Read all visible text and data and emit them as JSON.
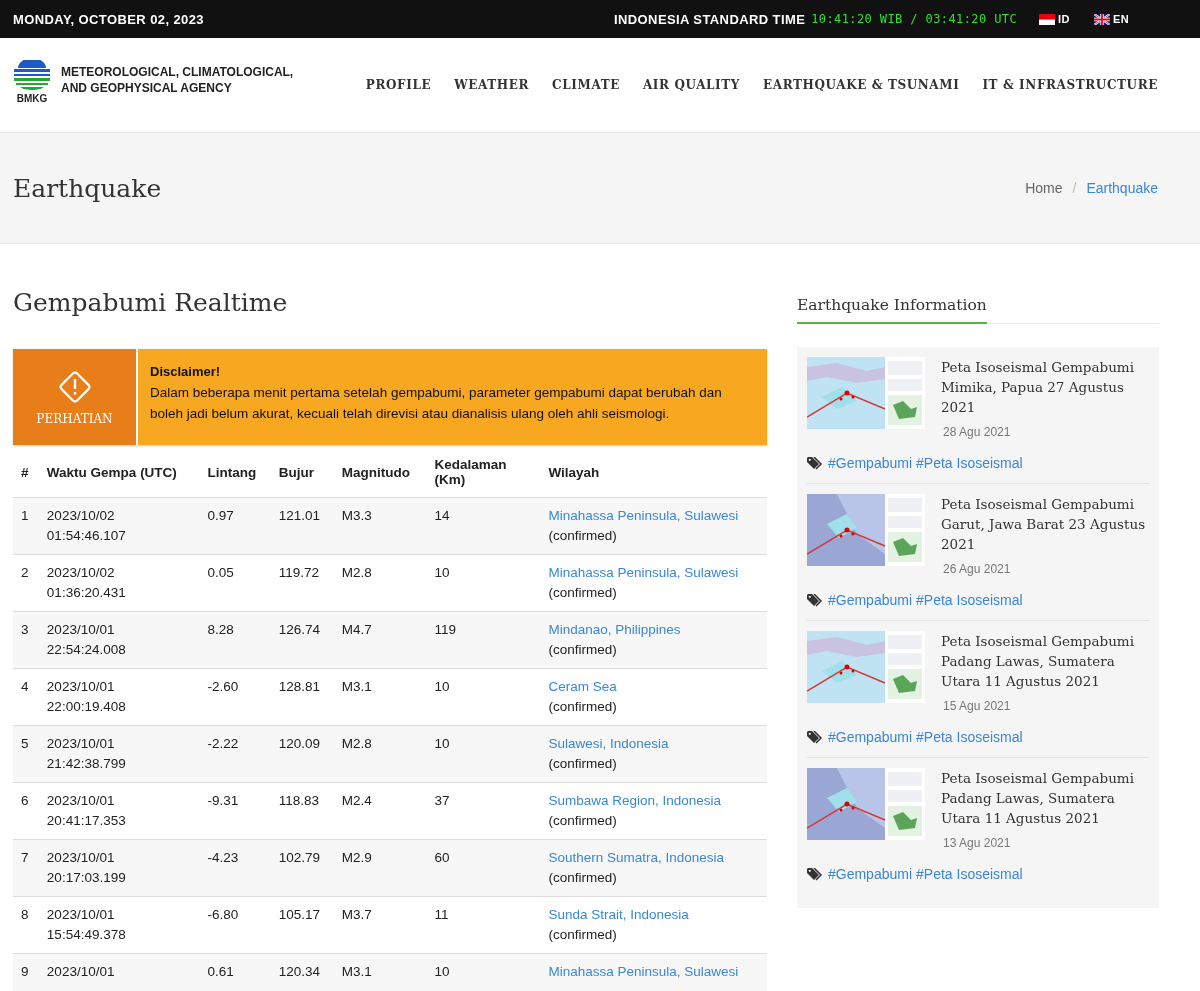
{
  "topbar": {
    "date": "MONDAY, OCTOBER 02, 2023",
    "time_label": "INDONESIA STANDARD TIME",
    "clock": "10:41:20 WIB / 03:41:20 UTC",
    "languages": [
      {
        "code": "ID",
        "kind": "indonesia"
      },
      {
        "code": "EN",
        "kind": "britain"
      }
    ]
  },
  "header": {
    "logo_text": "BMKG",
    "agency": "METEOROLOGICAL, CLIMATOLOGICAL, AND GEOPHYSICAL AGENCY",
    "nav": [
      "PROFILE",
      "WEATHER",
      "CLIMATE",
      "AIR QUALITY",
      "EARTHQUAKE & TSUNAMI",
      "IT & INFRASTRUCTURE"
    ]
  },
  "page_title": "Earthquake",
  "breadcrumb": [
    {
      "label": "Home",
      "current": false
    },
    {
      "separator": "/",
      "label": "Earthquake",
      "current": true
    }
  ],
  "section_title": "Gempabumi Realtime",
  "alert": {
    "label": "PERHATIAN",
    "title": "Disclaimer!",
    "text": "Dalam beberapa menit pertama setelah gempabumi, parameter gempabumi dapat berubah dan boleh jadi belum akurat, kecuali telah direvisi atau dianalisis ulang oleh ahli seismologi."
  },
  "table": {
    "columns": [
      "#",
      "Waktu Gempa (UTC)",
      "Lintang",
      "Bujur",
      "Magnitudo",
      "Kedalaman (Km)",
      "Wilayah"
    ],
    "rows": [
      {
        "no": "1",
        "date": "2023/10/02",
        "time": "01:54:46.107",
        "lat": "0.97",
        "lon": "121.01",
        "mag": "M3.3",
        "depth": "14",
        "region": "Minahassa Peninsula, Sulawesi",
        "status": "(confirmed)"
      },
      {
        "no": "2",
        "date": "2023/10/02",
        "time": "01:36:20.431",
        "lat": "0.05",
        "lon": "119.72",
        "mag": "M2.8",
        "depth": "10",
        "region": "Minahassa Peninsula, Sulawesi",
        "status": "(confirmed)"
      },
      {
        "no": "3",
        "date": "2023/10/01",
        "time": "22:54:24.008",
        "lat": "8.28",
        "lon": "126.74",
        "mag": "M4.7",
        "depth": "119",
        "region": "Mindanao, Philippines",
        "status": "(confirmed)"
      },
      {
        "no": "4",
        "date": "2023/10/01",
        "time": "22:00:19.408",
        "lat": "-2.60",
        "lon": "128.81",
        "mag": "M3.1",
        "depth": "10",
        "region": "Ceram Sea",
        "status": "(confirmed)"
      },
      {
        "no": "5",
        "date": "2023/10/01",
        "time": "21:42:38.799",
        "lat": "-2.22",
        "lon": "120.09",
        "mag": "M2.8",
        "depth": "10",
        "region": "Sulawesi, Indonesia",
        "status": "(confirmed)"
      },
      {
        "no": "6",
        "date": "2023/10/01",
        "time": "20:41:17.353",
        "lat": "-9.31",
        "lon": "118.83",
        "mag": "M2.4",
        "depth": "37",
        "region": "Sumbawa Region, Indonesia",
        "status": "(confirmed)"
      },
      {
        "no": "7",
        "date": "2023/10/01",
        "time": "20:17:03.199",
        "lat": "-4.23",
        "lon": "102.79",
        "mag": "M2.9",
        "depth": "60",
        "region": "Southern Sumatra, Indonesia",
        "status": "(confirmed)"
      },
      {
        "no": "8",
        "date": "2023/10/01",
        "time": "15:54:49.378",
        "lat": "-6.80",
        "lon": "105.17",
        "mag": "M3.7",
        "depth": "11",
        "region": "Sunda Strait, Indonesia",
        "status": "(confirmed)"
      },
      {
        "no": "9",
        "date": "2023/10/01",
        "lat": "0.61",
        "lon": "120.34",
        "mag": "M3.1",
        "depth": "10",
        "region": "Minahassa Peninsula, Sulawesi"
      }
    ]
  },
  "sidebar": {
    "title": "Earthquake Information",
    "posts": [
      {
        "kind": "picture",
        "title": "Peta Isoseismal Gempabumi Mimika, Papua 27 Agustus 2021",
        "date": "28 Agu 2021",
        "tags": [
          "#Gempabumi",
          "#Peta Isoseismal"
        ]
      },
      {
        "kind": "picture",
        "title": "Peta Isoseismal Gempabumi Garut, Jawa Barat 23 Agustus 2021",
        "date": "26 Agu 2021",
        "tags": [
          "#Gempabumi",
          "#Peta Isoseismal"
        ]
      },
      {
        "kind": "picture",
        "title": "Peta Isoseismal Gempabumi Padang Lawas, Sumatera Utara 11 Agustus 2021",
        "date": "15 Agu 2021",
        "tags": [
          "#Gempabumi",
          "#Peta Isoseismal"
        ]
      },
      {
        "kind": "picture",
        "title": "Peta Isoseismal Gempabumi Padang Lawas, Sumatera Utara 11 Agustus 2021",
        "date": "13 Agu 2021",
        "tags": [
          "#Gempabumi",
          "#Peta Isoseismal"
        ]
      }
    ]
  }
}
